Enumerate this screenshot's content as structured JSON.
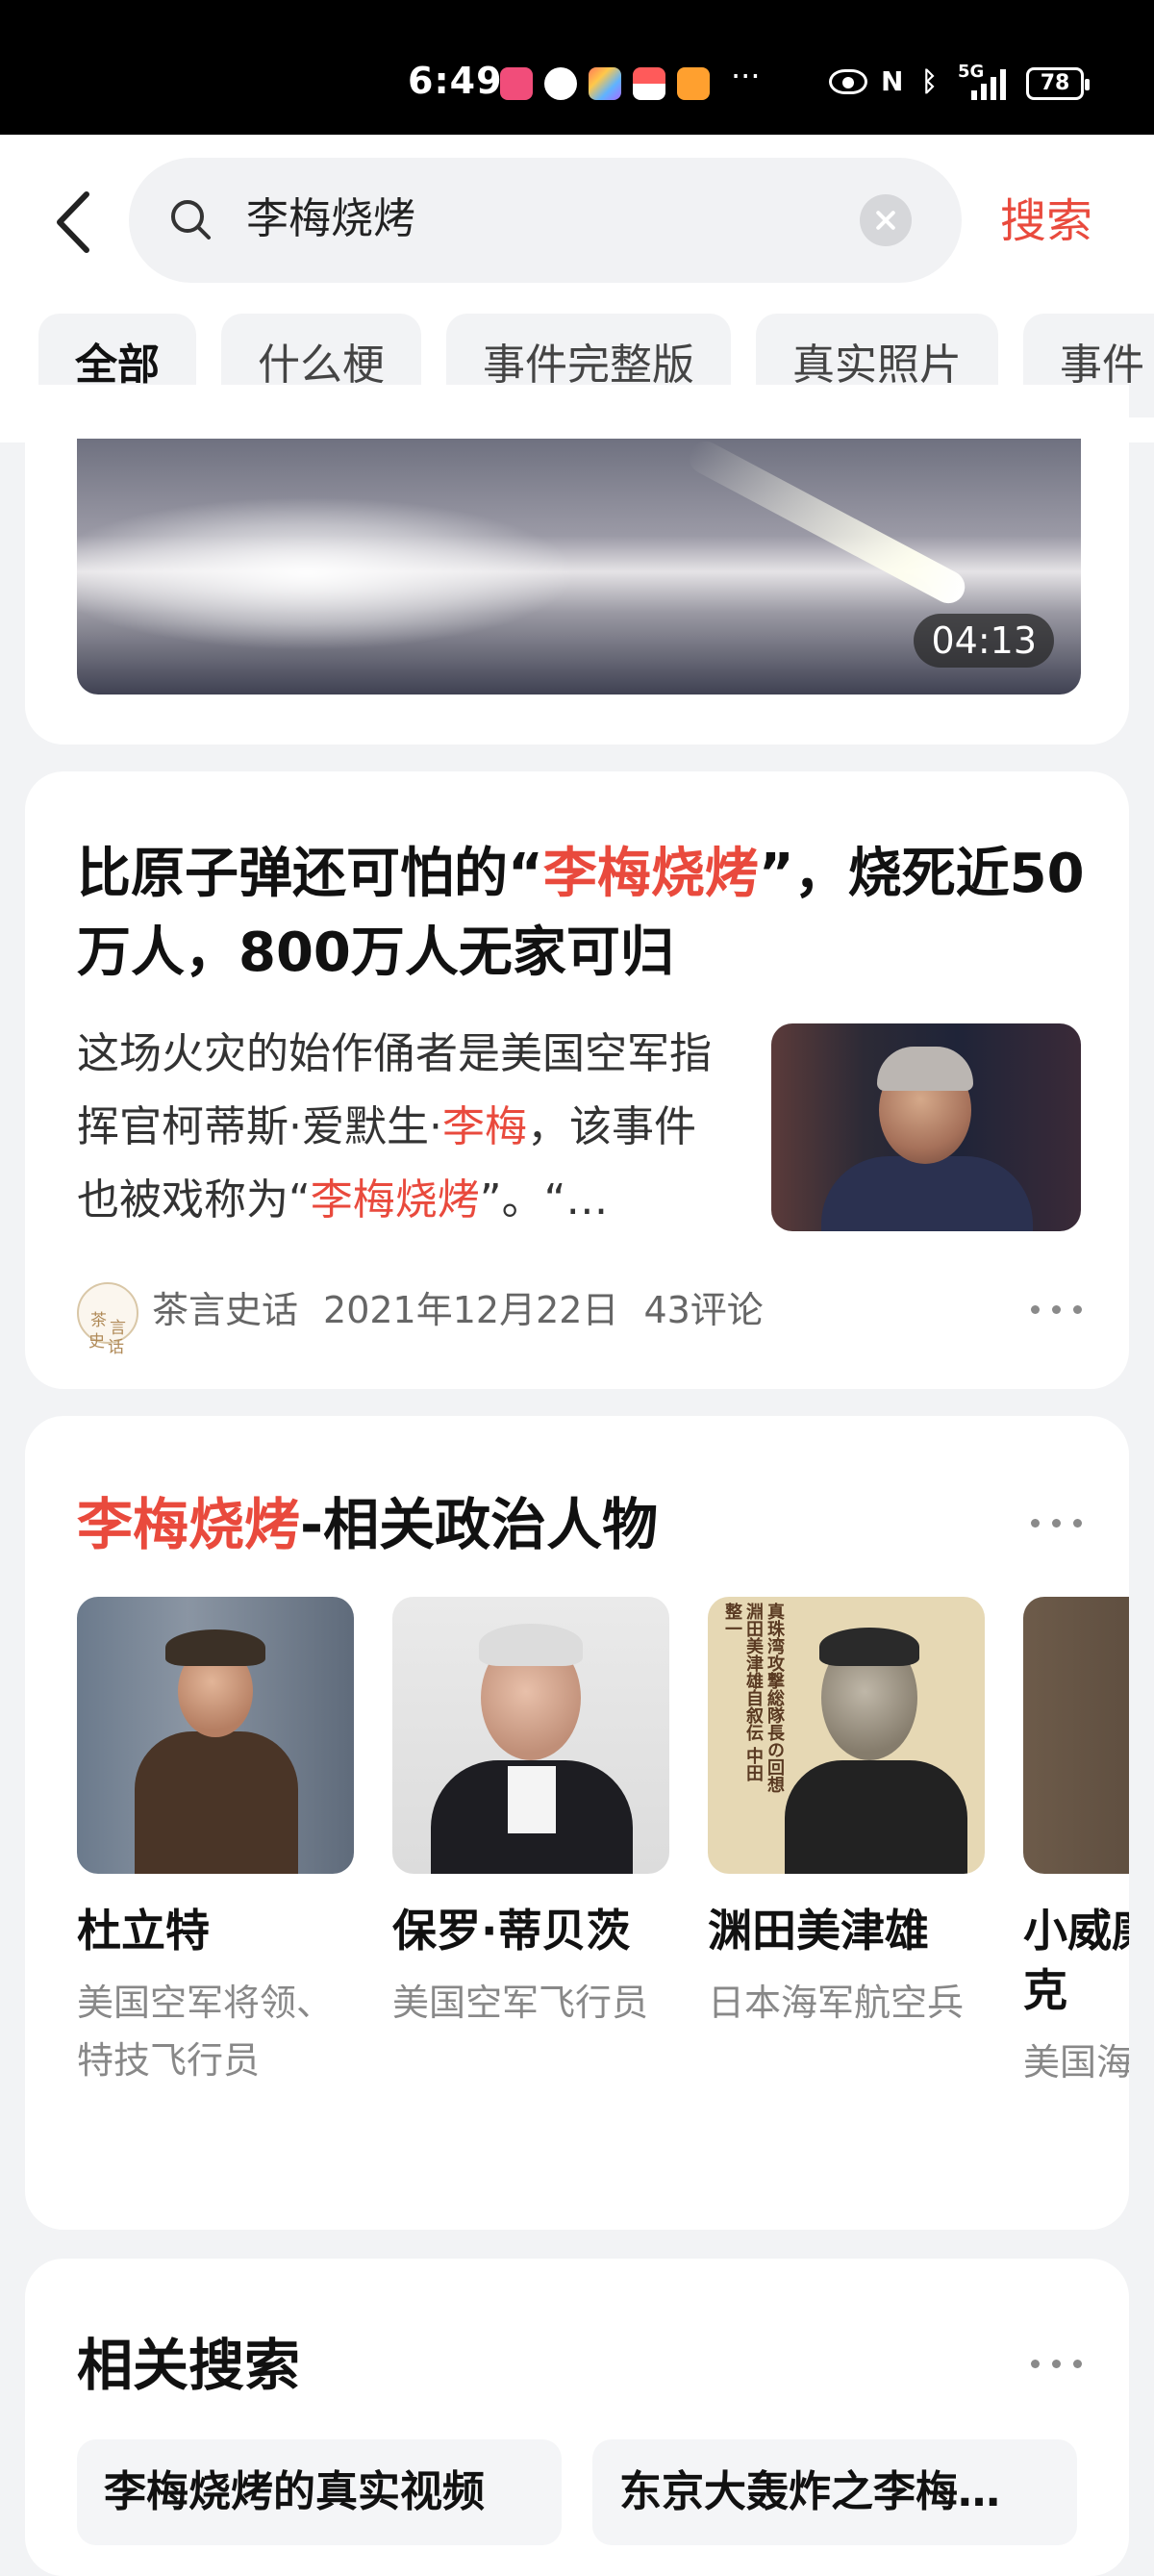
{
  "status_bar": {
    "time": "6:49",
    "signal": "5G",
    "battery": "78",
    "more": "···"
  },
  "search": {
    "query": "李梅烧烤",
    "button_label": "搜索"
  },
  "tabs": [
    {
      "label": "全部",
      "active": true
    },
    {
      "label": "什么梗"
    },
    {
      "label": "事件完整版"
    },
    {
      "label": "真实照片"
    },
    {
      "label": "事件"
    }
  ],
  "video": {
    "duration": "04:13"
  },
  "article": {
    "title_pre": "比原子弹还可怕的“",
    "title_hl": "李梅烧烤",
    "title_post": "”，烧死近50万人，800万人无家可归",
    "desc_1": "这场火灾的始作俑者是美国空军指挥官柯蒂斯·爱默生·",
    "desc_hl_1": "李梅",
    "desc_2": "，该事件也被戏称为“",
    "desc_hl_2": "李梅烧烤",
    "desc_3": "”。“…",
    "source": "茶言史话",
    "avatar_chars": [
      "茶",
      "言",
      "史",
      "话"
    ],
    "date": "2021年12月22日",
    "comments": "43评论"
  },
  "people_section": {
    "title_hl": "李梅烧烤",
    "title_rest": "-相关政治人物",
    "people": [
      {
        "name": "杜立特",
        "desc": "美国空军将领、特技飞行员"
      },
      {
        "name": "保罗·蒂贝茨",
        "desc": "美国空军飞行员"
      },
      {
        "name": "渊田美津雄",
        "desc": "日本海军航空兵"
      },
      {
        "name": "小威廉·德里克",
        "desc": "美国海军军官"
      }
    ],
    "book_text": "真珠湾攻撃総隊長の回想 淵田美津雄自叙伝 中田整一"
  },
  "related": {
    "title": "相关搜索",
    "items": [
      "李梅烧烤的真实视频",
      "东京大轰炸之李梅…"
    ]
  },
  "colors": {
    "accent": "#e94a3d",
    "background": "#f2f3f5"
  }
}
